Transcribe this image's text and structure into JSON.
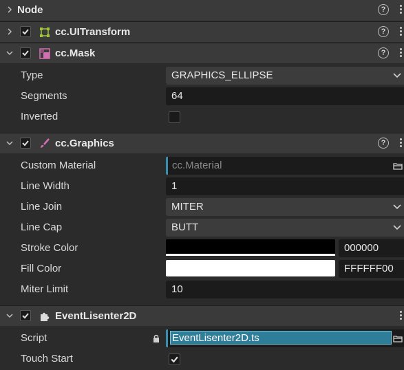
{
  "node": {
    "title": "Node"
  },
  "components": {
    "ui_transform": {
      "title": "cc.UITransform"
    },
    "mask": {
      "title": "cc.Mask",
      "type_label": "Type",
      "type_value": "GRAPHICS_ELLIPSE",
      "segments_label": "Segments",
      "segments_value": "64",
      "inverted_label": "Inverted"
    },
    "graphics": {
      "title": "cc.Graphics",
      "custom_material_label": "Custom Material",
      "custom_material_value": "cc.Material",
      "line_width_label": "Line Width",
      "line_width_value": "1",
      "line_join_label": "Line Join",
      "line_join_value": "MITER",
      "line_cap_label": "Line Cap",
      "line_cap_value": "BUTT",
      "stroke_color_label": "Stroke Color",
      "stroke_color_hex": "000000",
      "stroke_color": "#000000",
      "fill_color_label": "Fill Color",
      "fill_color_hex": "FFFFFF00",
      "fill_color": "#ffffff",
      "miter_limit_label": "Miter Limit",
      "miter_limit_value": "10"
    },
    "event_listener": {
      "title": "EventLisenter2D",
      "script_label": "Script",
      "script_value": "EventLisenter2D.ts",
      "touch_start_label": "Touch Start"
    }
  },
  "help_glyph": "?",
  "colors": {
    "accent": "#3a8fb0",
    "header_bg": "#3a3a3a",
    "field_bg": "#1b1b1b"
  }
}
